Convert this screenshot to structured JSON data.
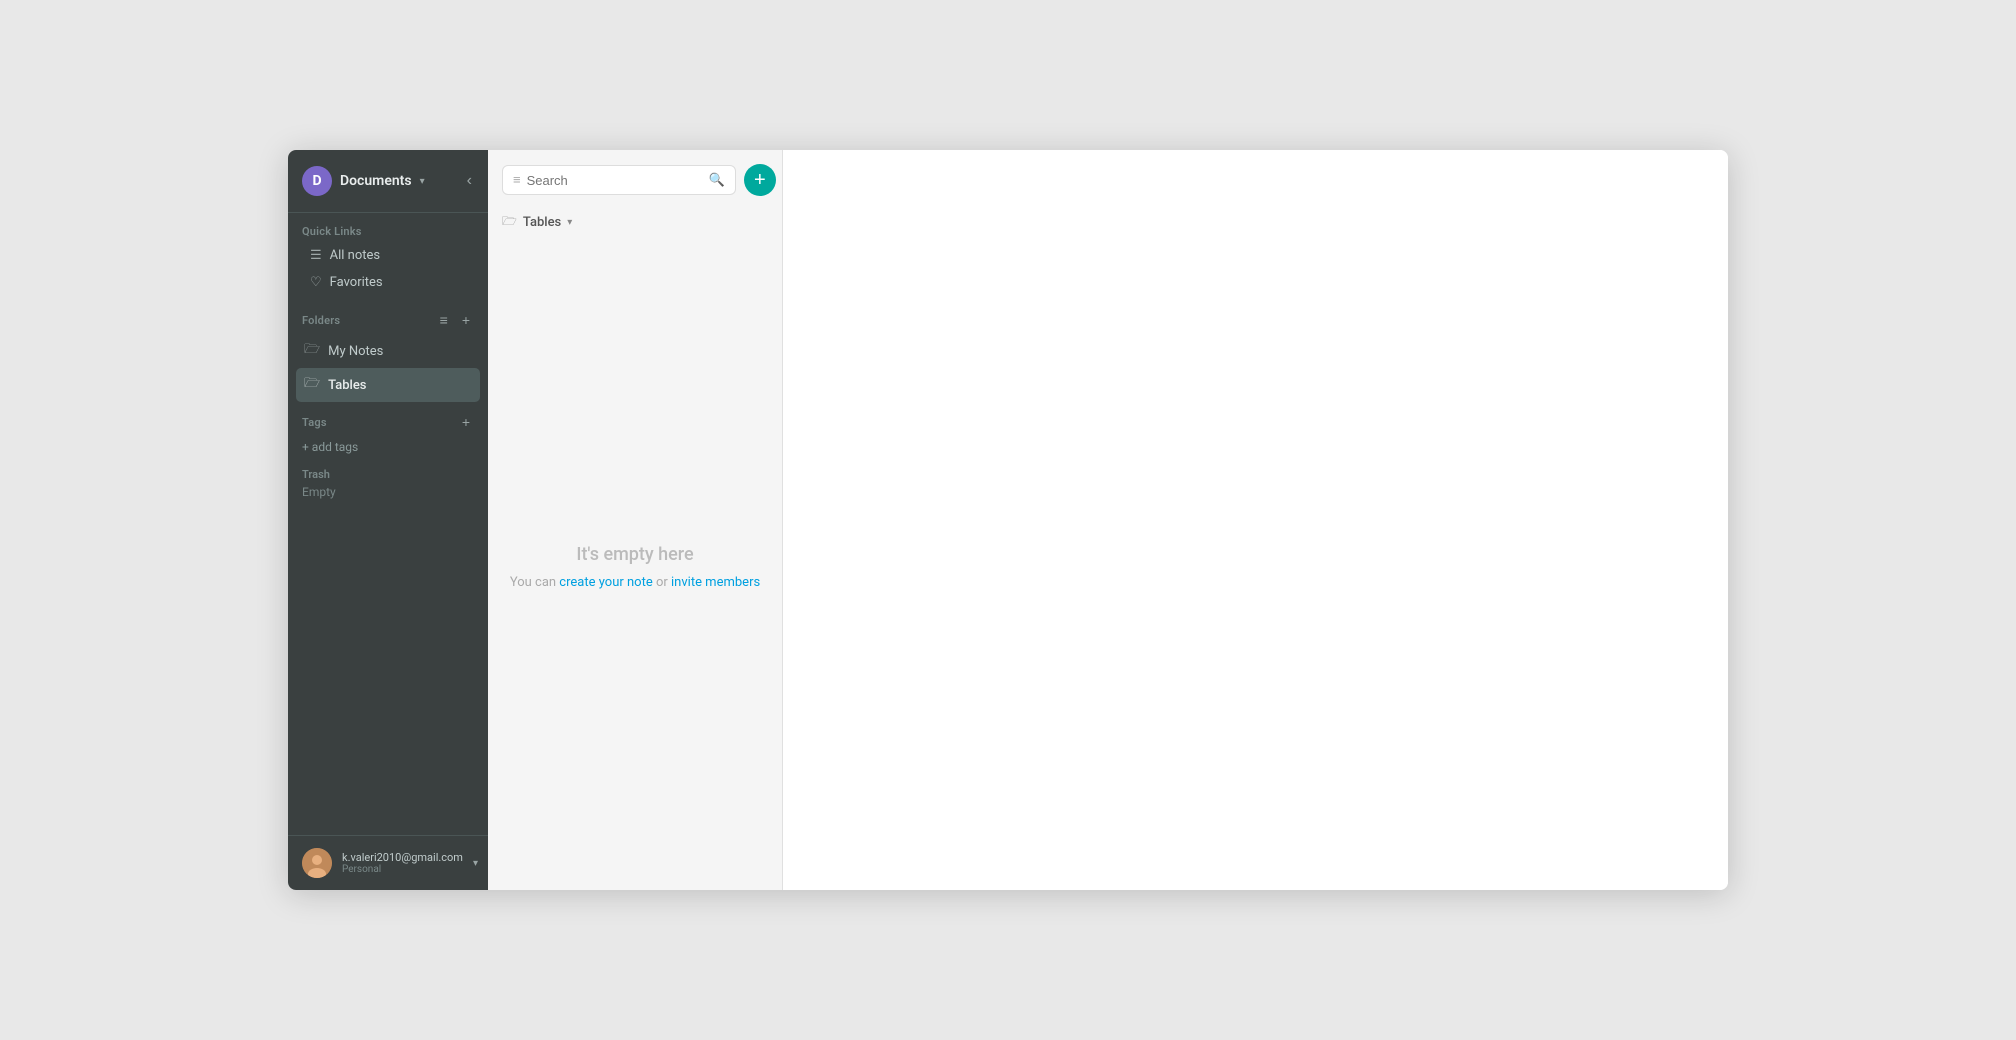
{
  "sidebar": {
    "workspace_initial": "D",
    "workspace_name": "Documents",
    "workspace_chevron": "▾",
    "collapse_icon": "‹",
    "quick_links_label": "Quick Links",
    "quick_links": [
      {
        "id": "all-notes",
        "label": "All notes",
        "icon": "☰"
      },
      {
        "id": "favorites",
        "label": "Favorites",
        "icon": "♡"
      }
    ],
    "folders_label": "Folders",
    "sort_icon": "≡",
    "add_folder_icon": "+",
    "folders": [
      {
        "id": "my-notes",
        "label": "My Notes",
        "icon": "🗁",
        "active": false
      },
      {
        "id": "tables",
        "label": "Tables",
        "icon": "🗁",
        "active": true
      }
    ],
    "tags_label": "Tags",
    "add_tag_icon": "+",
    "add_tags_label": "+ add tags",
    "trash_label": "Trash",
    "trash_empty_label": "Empty",
    "user_email": "k.valeri2010@gmail.com",
    "user_plan": "Personal",
    "user_chevron": "▾"
  },
  "notes_panel": {
    "search_placeholder": "Search",
    "add_btn_icon": "+",
    "folder_name": "Tables",
    "empty_title": "It's empty here",
    "empty_subtitle_prefix": "You can ",
    "create_note_label": "create your note",
    "empty_or": " or ",
    "invite_label": "invite members"
  }
}
